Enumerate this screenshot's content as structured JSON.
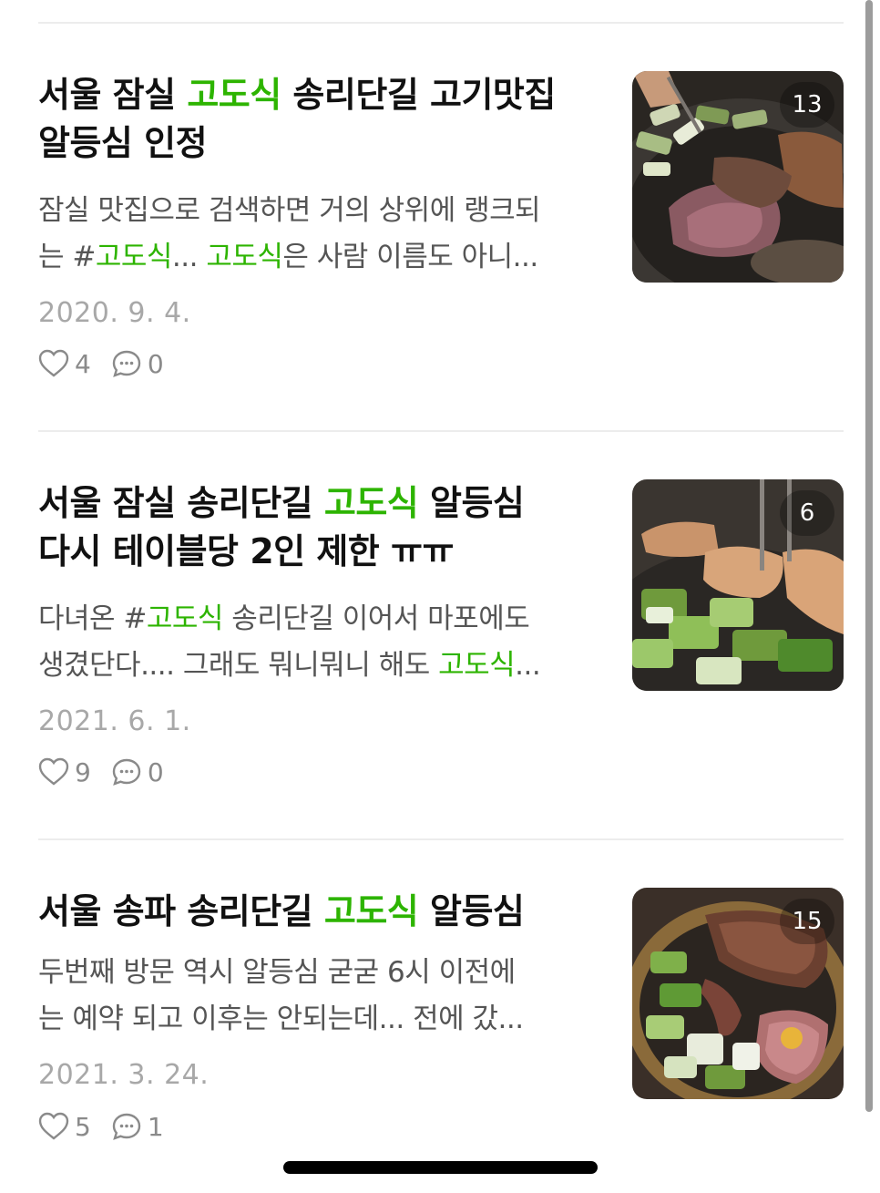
{
  "posts": [
    {
      "title_parts": [
        "서울 잠실 ",
        "고도식",
        " 송리단길 고기맛집",
        "알등심 인정"
      ],
      "excerpt_lines": [
        [
          "잠실 맛집으로 검색하면 거의 상위에 랭크되"
        ],
        [
          "는 #",
          "고도식",
          "... ",
          "고도식",
          "은 사람 이름도 아니..."
        ]
      ],
      "date": "2020. 9. 4.",
      "likes": "4",
      "comments": "0",
      "photo_count": "13",
      "like_icon": "heart-icon",
      "comment_icon": "comment-bubble-icon"
    },
    {
      "title_parts": [
        "서울 잠실 송리단길 ",
        "고도식",
        " 알등심",
        "다시 테이블당 2인 제한 ㅠㅠ"
      ],
      "excerpt_lines": [
        [
          "다녀온 #",
          "고도식",
          " 송리단길 이어서 마포에도"
        ],
        [
          "생겼단다.... 그래도 뭐니뭐니 해도 ",
          "고도식",
          "..."
        ]
      ],
      "date": "2021. 6. 1.",
      "likes": "9",
      "comments": "0",
      "photo_count": "6",
      "like_icon": "heart-icon",
      "comment_icon": "comment-bubble-icon"
    },
    {
      "title_parts": [
        "서울 송파 송리단길 ",
        "고도식",
        " 알등심"
      ],
      "excerpt_lines": [
        [
          "두번째 방문 역시 알등심 굳굳 6시 이전에"
        ],
        [
          "는 예약 되고 이후는 안되는데... 전에 갔..."
        ]
      ],
      "date": "2021. 3. 24.",
      "likes": "5",
      "comments": "1",
      "photo_count": "15",
      "like_icon": "heart-icon",
      "comment_icon": "comment-bubble-icon"
    }
  ],
  "colors": {
    "highlight": "#2db400",
    "title": "#111111",
    "excerpt": "#555555",
    "date": "#a8a8a8"
  }
}
